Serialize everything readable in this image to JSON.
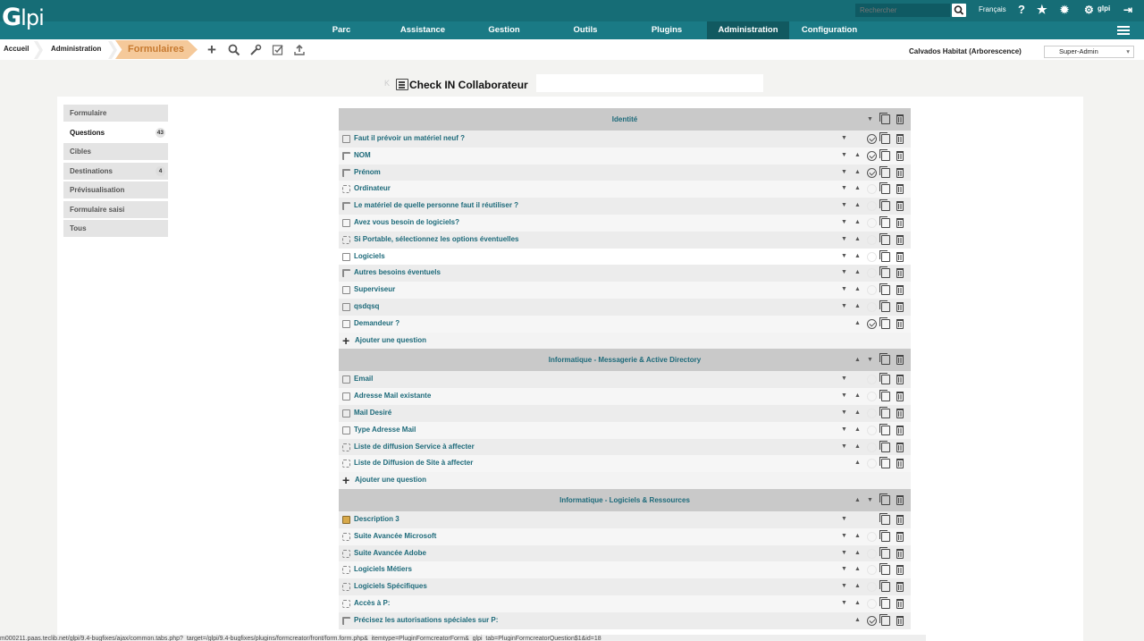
{
  "app": {
    "logo_first": "G",
    "logo_rest": "lpi"
  },
  "top": {
    "search_placeholder": "Rechercher",
    "language": "Français",
    "user": "glpi"
  },
  "menu": [
    {
      "label": "Parc"
    },
    {
      "label": "Assistance"
    },
    {
      "label": "Gestion"
    },
    {
      "label": "Outils"
    },
    {
      "label": "Plugins"
    },
    {
      "label": "Administration",
      "active": true
    },
    {
      "label": "Configuration"
    }
  ],
  "breadcrumb": {
    "home": "Accueil",
    "admin": "Administration",
    "current": "Formulaires"
  },
  "entity": "Calvados Habitat (Arborescence)",
  "profile": "Super-Admin",
  "form_title": "Check IN Collaborateur",
  "tabs": [
    {
      "label": "Formulaire"
    },
    {
      "label": "Questions",
      "count": "43",
      "active": true
    },
    {
      "label": "Cibles"
    },
    {
      "label": "Destinations",
      "count": "4"
    },
    {
      "label": "Prévisualisation"
    },
    {
      "label": "Formulaire saisi"
    },
    {
      "label": "Tous"
    }
  ],
  "add_question_label": "Ajouter une question",
  "sections": [
    {
      "name": "Identité",
      "questions": [
        {
          "label": "Faut il prévoir un matériel neuf ?",
          "required": true
        },
        {
          "label": "NOM",
          "required": true
        },
        {
          "label": "Prénom",
          "required": true
        },
        {
          "label": "Ordinateur",
          "required": false
        },
        {
          "label": "Le matériel de quelle personne faut il réutiliser ?",
          "required": false
        },
        {
          "label": "Avez vous besoin de logiciels?",
          "required": false
        },
        {
          "label": "Si Portable, sélectionnez les options éventuelles",
          "required": false
        },
        {
          "label": "Logiciels",
          "required": false
        },
        {
          "label": "Autres besoins éventuels",
          "required": false
        },
        {
          "label": "Superviseur",
          "required": false
        },
        {
          "label": "qsdqsq",
          "required": false
        },
        {
          "label": "Demandeur ?",
          "required": true
        }
      ]
    },
    {
      "name": "Informatique - Messagerie & Active Directory",
      "questions": [
        {
          "label": "Email",
          "required": false
        },
        {
          "label": "Adresse Mail existante",
          "required": false
        },
        {
          "label": "Mail Desiré",
          "required": false
        },
        {
          "label": "Type Adresse Mail",
          "required": false
        },
        {
          "label": "Liste de diffusion Service à affecter",
          "required": false
        },
        {
          "label": "Liste de Diffusion de Site à affecter",
          "required": false
        }
      ]
    },
    {
      "name": "Informatique - Logiciels & Ressources",
      "questions": [
        {
          "label": "Description 3",
          "required": false
        },
        {
          "label": "Suite Avancée Microsoft",
          "required": false
        },
        {
          "label": "Suite Avancée Adobe",
          "required": false
        },
        {
          "label": "Logiciels Métiers",
          "required": false
        },
        {
          "label": "Logiciels Spécifiques",
          "required": false
        },
        {
          "label": "Accès à P:",
          "required": false
        },
        {
          "label": "Précisez les autorisations spéciales sur P:",
          "required": true
        }
      ]
    }
  ],
  "status_url": "m000211.paas.teclib.net/glpi/9.4-bugfixes/ajax/common.tabs.php?_target=/glpi/9.4-bugfixes/plugins/formcreator/front/form.form.php&_itemtype=PluginFormcreatorForm&_glpi_tab=PluginFormcreatorQuestion$1&id=18"
}
